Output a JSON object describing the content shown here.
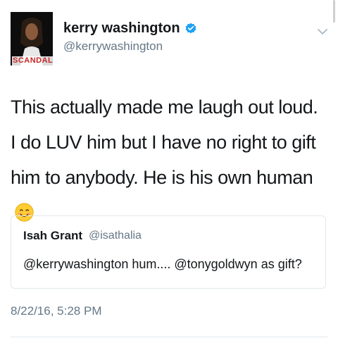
{
  "author": {
    "display_name": "kerry washington",
    "handle": "@kerrywashington",
    "avatar_logo_text": "SCANDAL"
  },
  "tweet": {
    "text": "This actually made me laugh out loud. I do LUV him but I have no right to gift him to anybody. He is his own human",
    "emoji": "smiling-face-emoji",
    "timestamp": "8/22/16, 5:28 PM"
  },
  "quoted_tweet": {
    "display_name": "Isah Grant",
    "handle": "@isathalia",
    "text": "@kerrywashington hum.... @tonygoldwyn as gift?"
  },
  "colors": {
    "verified_blue": "#1da1f2",
    "secondary_text": "#657786",
    "border": "#e1e8ed"
  }
}
